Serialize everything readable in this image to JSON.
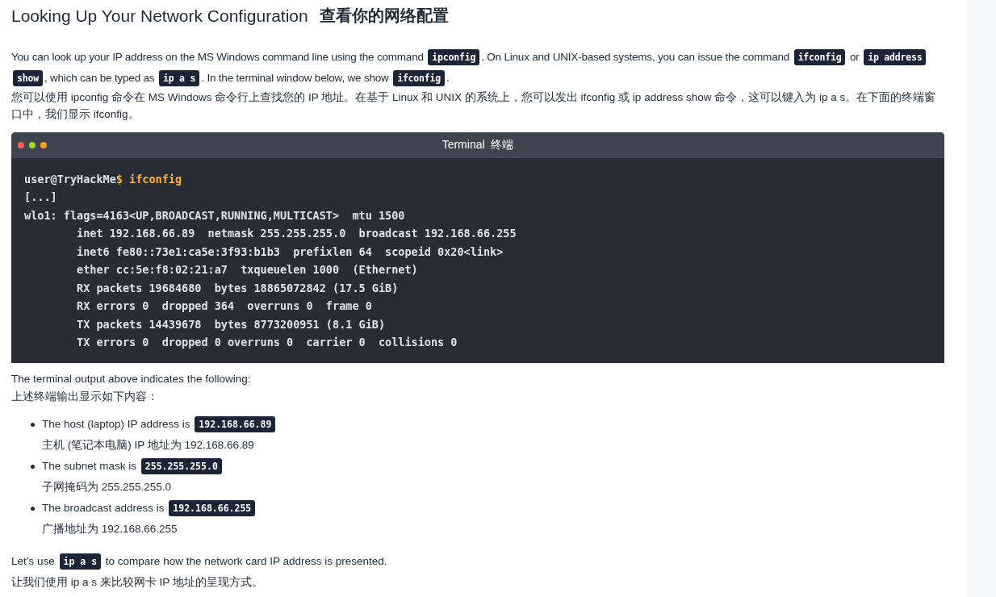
{
  "heading": {
    "english": "Looking Up Your Network Configuration",
    "chinese": "查看你的网络配置"
  },
  "intro": {
    "segments": [
      {
        "kind": "text",
        "text": "You can look up your IP address on the MS Windows command line using the command "
      },
      {
        "kind": "code",
        "text": "ipconfig"
      },
      {
        "kind": "text",
        "text": ". On Linux and UNIX-based systems, you can issue the command "
      },
      {
        "kind": "code",
        "text": "ifconfig"
      },
      {
        "kind": "text",
        "text": " or "
      },
      {
        "kind": "code",
        "text": "ip address show"
      },
      {
        "kind": "text",
        "text": ", which can be typed as "
      },
      {
        "kind": "code",
        "text": "ip a s"
      },
      {
        "kind": "text",
        "text": ". In the terminal window below, we show "
      },
      {
        "kind": "code",
        "text": "ifconfig"
      },
      {
        "kind": "text",
        "text": "."
      }
    ],
    "chinese": "您可以使用 ipconfig 命令在 MS Windows 命令行上查找您的 IP 地址。在基于 Linux 和 UNIX 的系统上，您可以发出 ifconfig 或 ip address show 命令，这可以键入为 ip a s。在下面的终端窗口中，我们显示 ifconfig。"
  },
  "terminal": {
    "title": "Terminal  终端",
    "prompt": "user@TryHackMe",
    "prompt_symbol": "$",
    "command": "ifconfig",
    "output": [
      "[...]",
      "wlo1: flags=4163<UP,BROADCAST,RUNNING,MULTICAST>  mtu 1500",
      "        inet 192.168.66.89  netmask 255.255.255.0  broadcast 192.168.66.255",
      "        inet6 fe80::73e1:ca5e:3f93:b1b3  prefixlen 64  scopeid 0x20<link>",
      "        ether cc:5e:f8:02:21:a7  txqueuelen 1000  (Ethernet)",
      "        RX packets 19684680  bytes 18865072842 (17.5 GiB)",
      "        RX errors 0  dropped 364  overruns 0  frame 0",
      "        TX packets 14439678  bytes 8773200951 (8.1 GiB)",
      "        TX errors 0  dropped 0 overruns 0  carrier 0  collisions 0"
    ]
  },
  "summary": {
    "english": "The terminal output above indicates the following:",
    "chinese": "上述终端输出显示如下内容："
  },
  "bullets": [
    {
      "text": "The host (laptop) IP address is ",
      "code": "192.168.66.89",
      "chinese": "主机 (笔记本电脑) IP 地址为 192.168.66.89"
    },
    {
      "text": "The subnet mask is ",
      "code": "255.255.255.0",
      "chinese": "子网掩码为 255.255.255.0"
    },
    {
      "text": "The broadcast address is ",
      "code": "192.168.66.255",
      "chinese": "广播地址为 192.168.66.255"
    }
  ],
  "closing": {
    "segments": [
      {
        "kind": "text",
        "text": "Let’s use "
      },
      {
        "kind": "code",
        "text": "ip a s"
      },
      {
        "kind": "text",
        "text": " to compare how the network card IP address is presented."
      }
    ],
    "chinese": "让我们使用 ip a s 来比较网卡 IP 地址的呈现方式。"
  }
}
